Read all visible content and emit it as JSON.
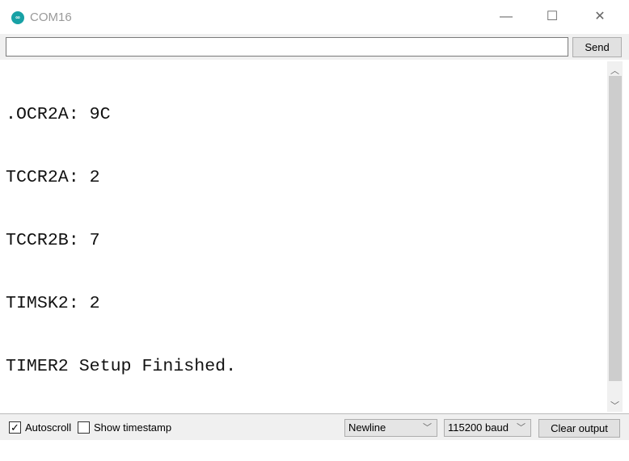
{
  "window": {
    "title": "COM16",
    "logo_text": "∞"
  },
  "input": {
    "value": "",
    "send_label": "Send"
  },
  "output_lines": [
    ".OCR2A: 9C",
    "TCCR2A: 2",
    "TCCR2B: 7",
    "TIMSK2: 2",
    "TIMER2 Setup Finished.",
    ".................."
  ],
  "footer": {
    "autoscroll_label": "Autoscroll",
    "autoscroll_checked": true,
    "timestamp_label": "Show timestamp",
    "timestamp_checked": false,
    "line_ending": "Newline",
    "baud": "115200 baud",
    "clear_label": "Clear output"
  },
  "colors": {
    "logo": "#17a1a5"
  }
}
